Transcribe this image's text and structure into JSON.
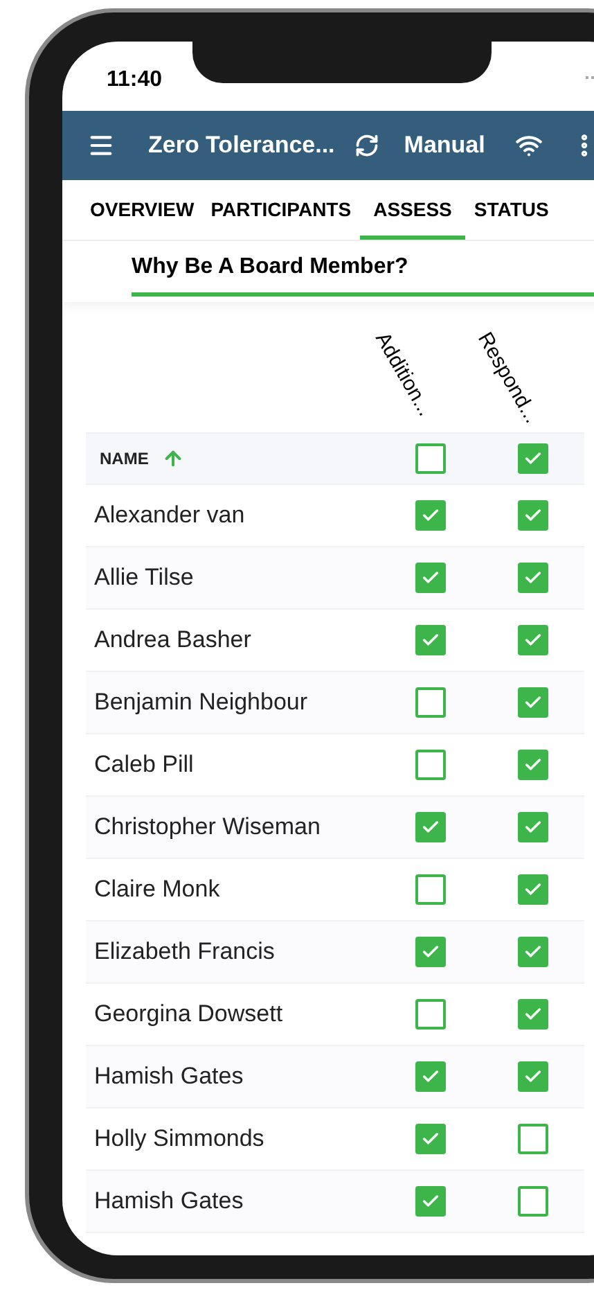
{
  "status_bar": {
    "time": "11:40"
  },
  "app_bar": {
    "title": "Zero Tolerance...",
    "mode": "Manual"
  },
  "tabs": [
    {
      "label": "OVERVIEW",
      "selected": false
    },
    {
      "label": "PARTICIPANTS",
      "selected": false
    },
    {
      "label": "ASSESS",
      "selected": true
    },
    {
      "label": "STATUS",
      "selected": false
    }
  ],
  "section_title": "Why Be A Board Member?",
  "table": {
    "columns": [
      {
        "label": "Addition..."
      },
      {
        "label": "Respond..."
      }
    ],
    "name_heading": "NAME",
    "header_checks": [
      {
        "checked": false
      },
      {
        "checked": true
      }
    ],
    "rows": [
      {
        "name": "Alexander van",
        "checks": [
          {
            "checked": true
          },
          {
            "checked": true
          }
        ]
      },
      {
        "name": "Allie Tilse",
        "checks": [
          {
            "checked": true
          },
          {
            "checked": true
          }
        ]
      },
      {
        "name": "Andrea Basher",
        "checks": [
          {
            "checked": true
          },
          {
            "checked": true
          }
        ]
      },
      {
        "name": "Benjamin Neighbour",
        "checks": [
          {
            "checked": false
          },
          {
            "checked": true
          }
        ]
      },
      {
        "name": "Caleb Pill",
        "checks": [
          {
            "checked": false
          },
          {
            "checked": true
          }
        ]
      },
      {
        "name": "Christopher Wiseman",
        "checks": [
          {
            "checked": true
          },
          {
            "checked": true
          }
        ]
      },
      {
        "name": "Claire Monk",
        "checks": [
          {
            "checked": false
          },
          {
            "checked": true
          }
        ]
      },
      {
        "name": "Elizabeth Francis",
        "checks": [
          {
            "checked": true
          },
          {
            "checked": true
          }
        ]
      },
      {
        "name": "Georgina Dowsett",
        "checks": [
          {
            "checked": false
          },
          {
            "checked": true
          }
        ]
      },
      {
        "name": "Hamish Gates",
        "checks": [
          {
            "checked": true
          },
          {
            "checked": true
          }
        ]
      },
      {
        "name": "Holly Simmonds",
        "checks": [
          {
            "checked": true
          },
          {
            "checked": false
          }
        ]
      },
      {
        "name": "Hamish Gates",
        "checks": [
          {
            "checked": true
          },
          {
            "checked": false
          }
        ]
      }
    ]
  }
}
